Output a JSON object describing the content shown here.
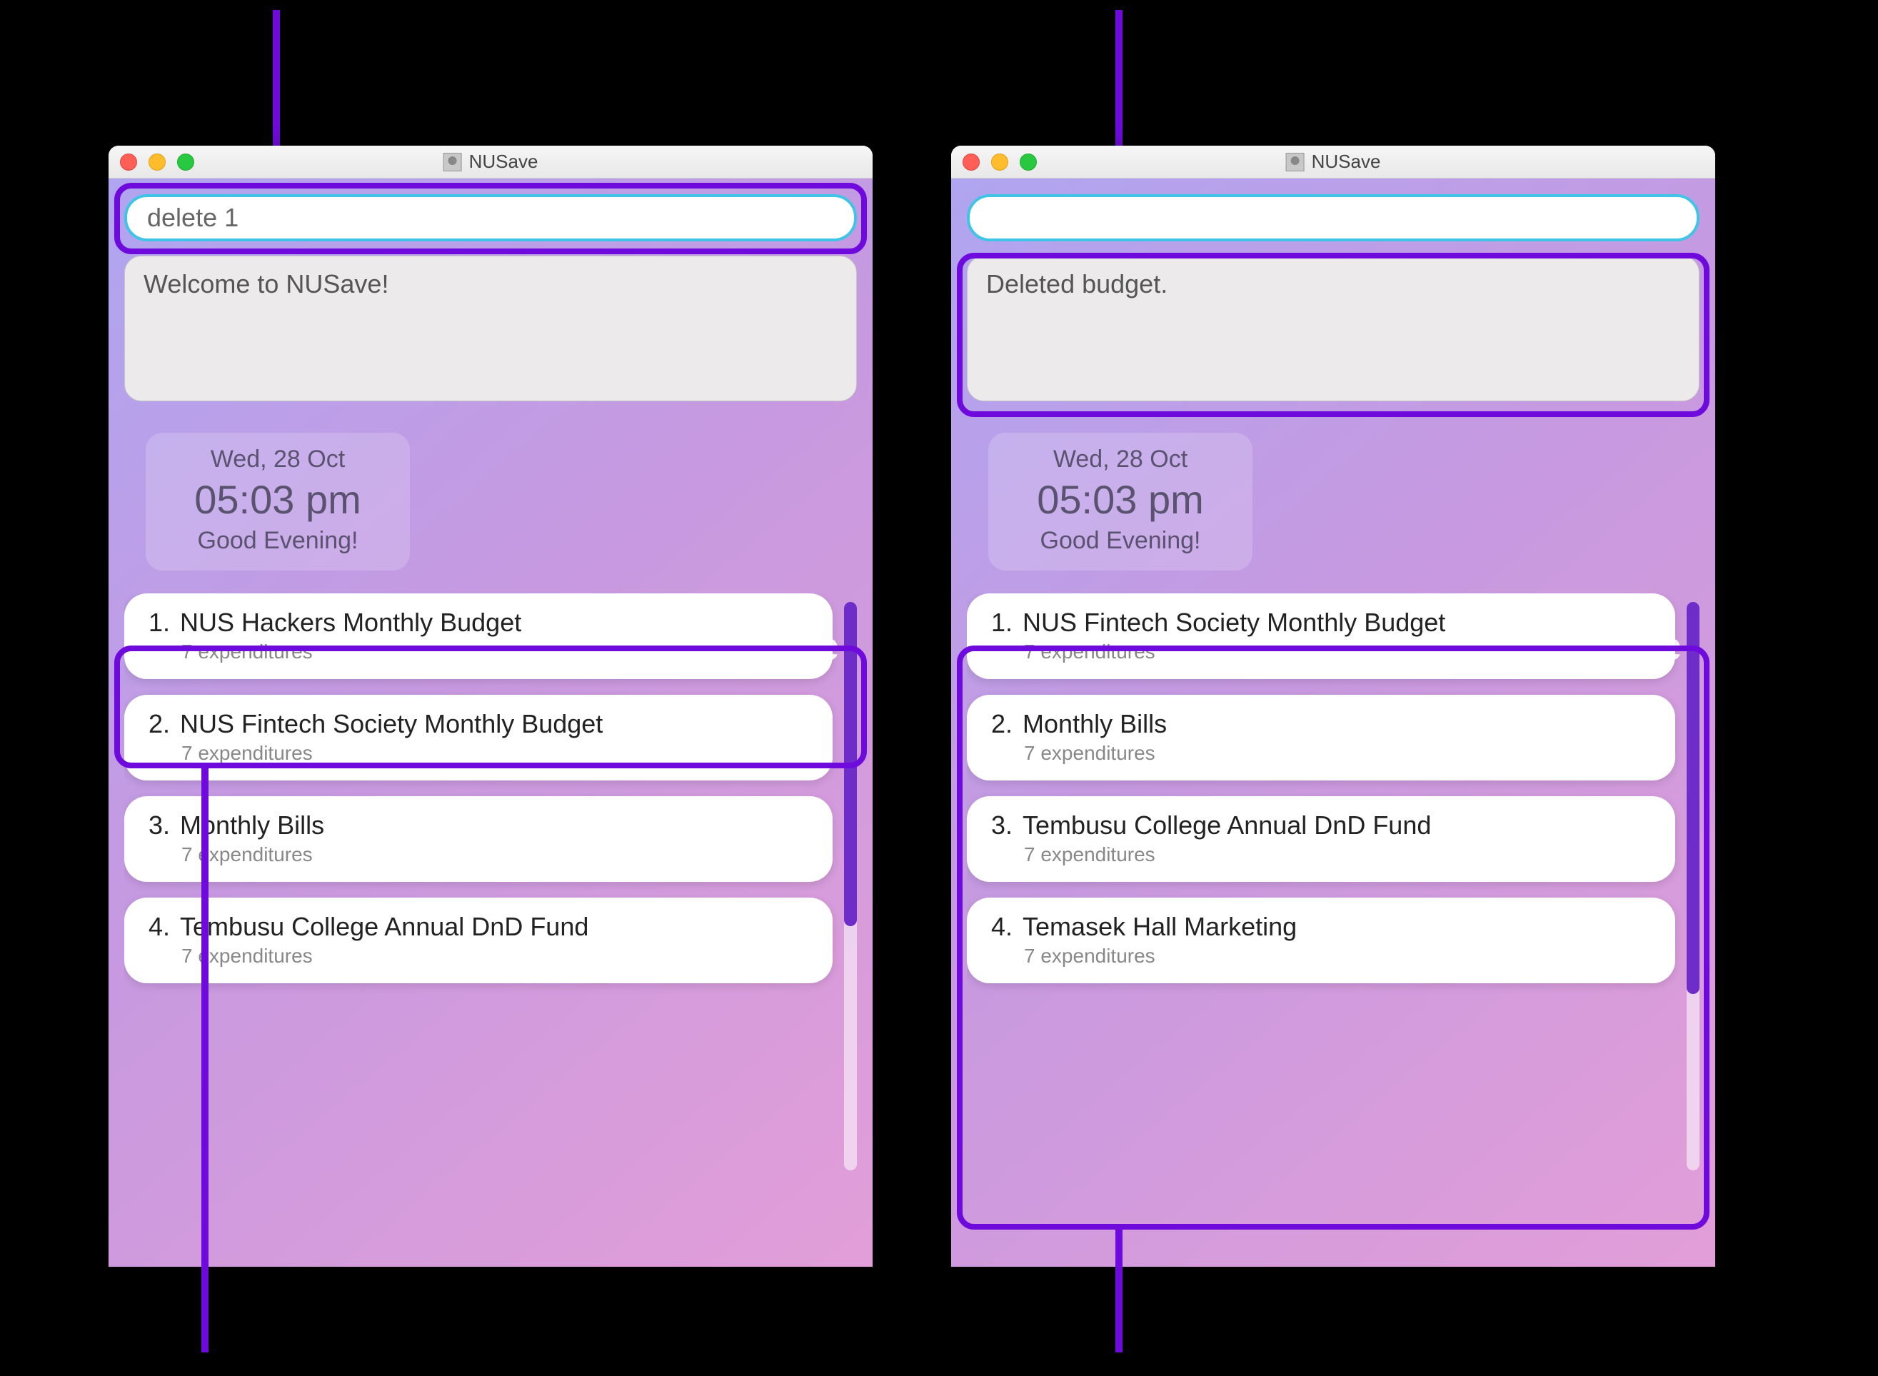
{
  "colors": {
    "highlight": "#6e0bdc",
    "accent_border": "#3fc4e6"
  },
  "left": {
    "window_title": "NUSave",
    "command_input_value": "delete 1",
    "message_text": "Welcome to NUSave!",
    "clock": {
      "date": "Wed, 28 Oct",
      "time": "05:03 pm",
      "greeting": "Good Evening!"
    },
    "logo": "NUSave",
    "budgets": [
      {
        "num": "1.",
        "title": "NUS Hackers Monthly Budget",
        "sub": "7 expenditures"
      },
      {
        "num": "2.",
        "title": "NUS Fintech Society Monthly Budget",
        "sub": "7 expenditures"
      },
      {
        "num": "3.",
        "title": "Monthly Bills",
        "sub": "7 expenditures"
      },
      {
        "num": "4.",
        "title": "Tembusu College Annual DnD Fund",
        "sub": "7 expenditures"
      }
    ]
  },
  "right": {
    "window_title": "NUSave",
    "command_input_value": "",
    "message_text": "Deleted budget.",
    "clock": {
      "date": "Wed, 28 Oct",
      "time": "05:03 pm",
      "greeting": "Good Evening!"
    },
    "logo": "NUSave",
    "budgets": [
      {
        "num": "1.",
        "title": "NUS Fintech Society Monthly Budget",
        "sub": "7 expenditures"
      },
      {
        "num": "2.",
        "title": "Monthly Bills",
        "sub": "7 expenditures"
      },
      {
        "num": "3.",
        "title": "Tembusu College Annual DnD Fund",
        "sub": "7 expenditures"
      },
      {
        "num": "4.",
        "title": "Temasek Hall Marketing",
        "sub": "7 expenditures"
      }
    ]
  }
}
